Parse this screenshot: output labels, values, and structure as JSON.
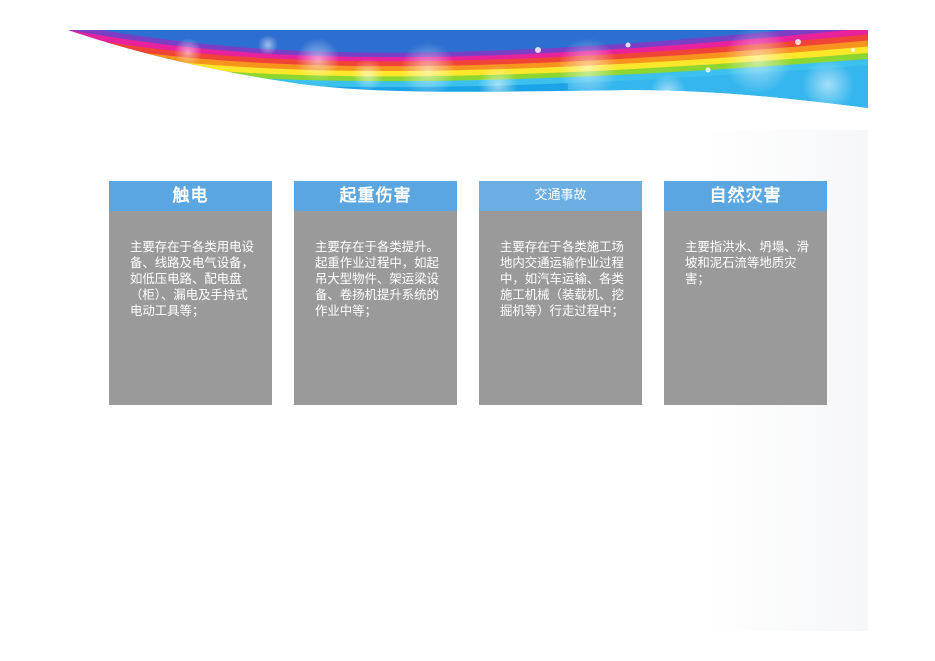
{
  "colors": {
    "header_blue": "#5aa6e0",
    "card_gray": "#9a9a9a",
    "text_white": "#ffffff"
  },
  "cards": [
    {
      "title": "触电",
      "body": "主要存在于各类用电设备、线路及电气设备，如低压电路、配电盘（柜）、漏电及手持式电动工具等；"
    },
    {
      "title": "起重伤害",
      "body": "主要存在于各类提升。起重作业过程中，如起吊大型物件、架运梁设备、卷扬机提升系统的作业中等；"
    },
    {
      "title": "交通事故",
      "body": "主要存在于各类施工场地内交通运输作业过程中，如汽车运输、各类施工机械（装载机、挖掘机等）行走过程中；"
    },
    {
      "title": "自然灾害",
      "body": "主要指洪水、坍塌、滑坡和泥石流等地质灾害；"
    }
  ]
}
